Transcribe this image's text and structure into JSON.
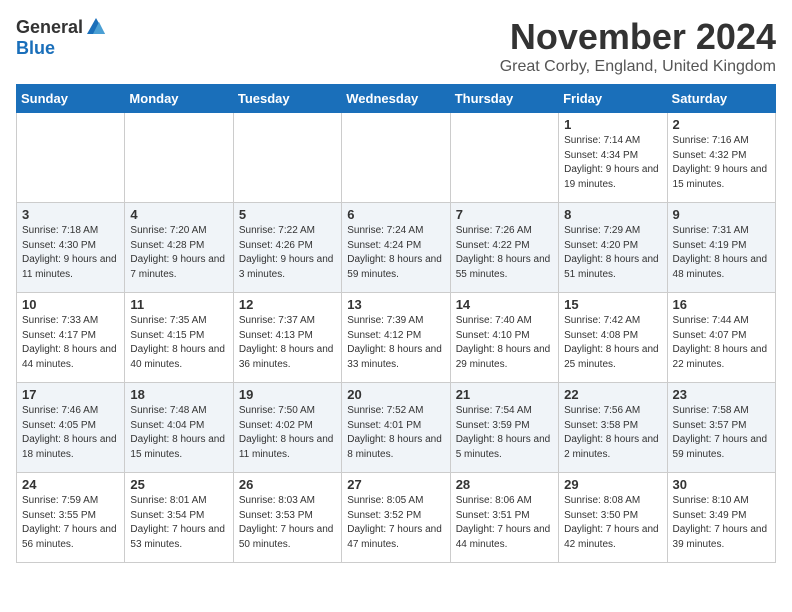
{
  "header": {
    "logo_general": "General",
    "logo_blue": "Blue",
    "month_title": "November 2024",
    "location": "Great Corby, England, United Kingdom"
  },
  "days_of_week": [
    "Sunday",
    "Monday",
    "Tuesday",
    "Wednesday",
    "Thursday",
    "Friday",
    "Saturday"
  ],
  "weeks": [
    [
      {
        "day": "",
        "info": ""
      },
      {
        "day": "",
        "info": ""
      },
      {
        "day": "",
        "info": ""
      },
      {
        "day": "",
        "info": ""
      },
      {
        "day": "",
        "info": ""
      },
      {
        "day": "1",
        "info": "Sunrise: 7:14 AM\nSunset: 4:34 PM\nDaylight: 9 hours\nand 19 minutes."
      },
      {
        "day": "2",
        "info": "Sunrise: 7:16 AM\nSunset: 4:32 PM\nDaylight: 9 hours\nand 15 minutes."
      }
    ],
    [
      {
        "day": "3",
        "info": "Sunrise: 7:18 AM\nSunset: 4:30 PM\nDaylight: 9 hours\nand 11 minutes."
      },
      {
        "day": "4",
        "info": "Sunrise: 7:20 AM\nSunset: 4:28 PM\nDaylight: 9 hours\nand 7 minutes."
      },
      {
        "day": "5",
        "info": "Sunrise: 7:22 AM\nSunset: 4:26 PM\nDaylight: 9 hours\nand 3 minutes."
      },
      {
        "day": "6",
        "info": "Sunrise: 7:24 AM\nSunset: 4:24 PM\nDaylight: 8 hours\nand 59 minutes."
      },
      {
        "day": "7",
        "info": "Sunrise: 7:26 AM\nSunset: 4:22 PM\nDaylight: 8 hours\nand 55 minutes."
      },
      {
        "day": "8",
        "info": "Sunrise: 7:29 AM\nSunset: 4:20 PM\nDaylight: 8 hours\nand 51 minutes."
      },
      {
        "day": "9",
        "info": "Sunrise: 7:31 AM\nSunset: 4:19 PM\nDaylight: 8 hours\nand 48 minutes."
      }
    ],
    [
      {
        "day": "10",
        "info": "Sunrise: 7:33 AM\nSunset: 4:17 PM\nDaylight: 8 hours\nand 44 minutes."
      },
      {
        "day": "11",
        "info": "Sunrise: 7:35 AM\nSunset: 4:15 PM\nDaylight: 8 hours\nand 40 minutes."
      },
      {
        "day": "12",
        "info": "Sunrise: 7:37 AM\nSunset: 4:13 PM\nDaylight: 8 hours\nand 36 minutes."
      },
      {
        "day": "13",
        "info": "Sunrise: 7:39 AM\nSunset: 4:12 PM\nDaylight: 8 hours\nand 33 minutes."
      },
      {
        "day": "14",
        "info": "Sunrise: 7:40 AM\nSunset: 4:10 PM\nDaylight: 8 hours\nand 29 minutes."
      },
      {
        "day": "15",
        "info": "Sunrise: 7:42 AM\nSunset: 4:08 PM\nDaylight: 8 hours\nand 25 minutes."
      },
      {
        "day": "16",
        "info": "Sunrise: 7:44 AM\nSunset: 4:07 PM\nDaylight: 8 hours\nand 22 minutes."
      }
    ],
    [
      {
        "day": "17",
        "info": "Sunrise: 7:46 AM\nSunset: 4:05 PM\nDaylight: 8 hours\nand 18 minutes."
      },
      {
        "day": "18",
        "info": "Sunrise: 7:48 AM\nSunset: 4:04 PM\nDaylight: 8 hours\nand 15 minutes."
      },
      {
        "day": "19",
        "info": "Sunrise: 7:50 AM\nSunset: 4:02 PM\nDaylight: 8 hours\nand 11 minutes."
      },
      {
        "day": "20",
        "info": "Sunrise: 7:52 AM\nSunset: 4:01 PM\nDaylight: 8 hours\nand 8 minutes."
      },
      {
        "day": "21",
        "info": "Sunrise: 7:54 AM\nSunset: 3:59 PM\nDaylight: 8 hours\nand 5 minutes."
      },
      {
        "day": "22",
        "info": "Sunrise: 7:56 AM\nSunset: 3:58 PM\nDaylight: 8 hours\nand 2 minutes."
      },
      {
        "day": "23",
        "info": "Sunrise: 7:58 AM\nSunset: 3:57 PM\nDaylight: 7 hours\nand 59 minutes."
      }
    ],
    [
      {
        "day": "24",
        "info": "Sunrise: 7:59 AM\nSunset: 3:55 PM\nDaylight: 7 hours\nand 56 minutes."
      },
      {
        "day": "25",
        "info": "Sunrise: 8:01 AM\nSunset: 3:54 PM\nDaylight: 7 hours\nand 53 minutes."
      },
      {
        "day": "26",
        "info": "Sunrise: 8:03 AM\nSunset: 3:53 PM\nDaylight: 7 hours\nand 50 minutes."
      },
      {
        "day": "27",
        "info": "Sunrise: 8:05 AM\nSunset: 3:52 PM\nDaylight: 7 hours\nand 47 minutes."
      },
      {
        "day": "28",
        "info": "Sunrise: 8:06 AM\nSunset: 3:51 PM\nDaylight: 7 hours\nand 44 minutes."
      },
      {
        "day": "29",
        "info": "Sunrise: 8:08 AM\nSunset: 3:50 PM\nDaylight: 7 hours\nand 42 minutes."
      },
      {
        "day": "30",
        "info": "Sunrise: 8:10 AM\nSunset: 3:49 PM\nDaylight: 7 hours\nand 39 minutes."
      }
    ]
  ]
}
